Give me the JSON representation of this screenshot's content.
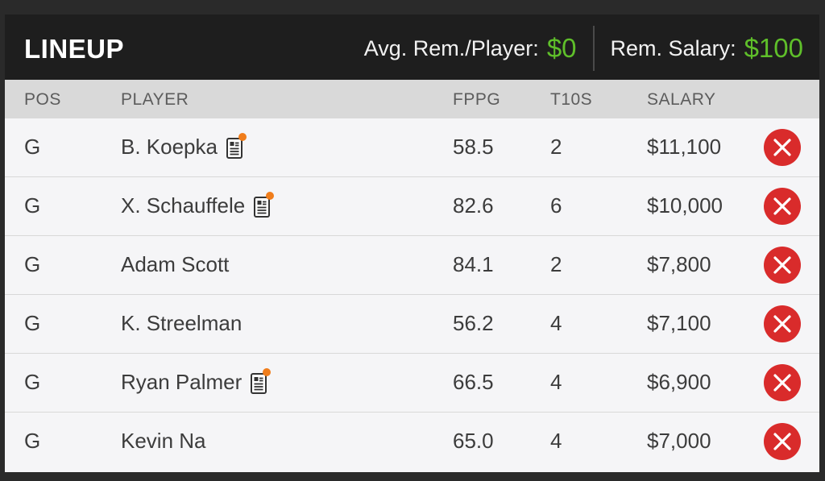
{
  "header": {
    "title": "LINEUP",
    "avg_label": "Avg. Rem./Player:",
    "avg_value": "$0",
    "rem_label": "Rem. Salary:",
    "rem_value": "$100"
  },
  "columns": {
    "pos": "POS",
    "player": "PLAYER",
    "fppg": "FPPG",
    "t10s": "T10S",
    "salary": "SALARY"
  },
  "colors": {
    "accent_green": "#5fbf2a",
    "remove_red": "#d92b2b",
    "news_dot_orange": "#f07d1b"
  },
  "players": [
    {
      "pos": "G",
      "name": "B. Koepka",
      "has_news": true,
      "fppg": "58.5",
      "t10s": "2",
      "salary": "$11,100"
    },
    {
      "pos": "G",
      "name": "X. Schauffele",
      "has_news": true,
      "fppg": "82.6",
      "t10s": "6",
      "salary": "$10,000"
    },
    {
      "pos": "G",
      "name": "Adam Scott",
      "has_news": false,
      "fppg": "84.1",
      "t10s": "2",
      "salary": "$7,800"
    },
    {
      "pos": "G",
      "name": "K. Streelman",
      "has_news": false,
      "fppg": "56.2",
      "t10s": "4",
      "salary": "$7,100"
    },
    {
      "pos": "G",
      "name": "Ryan Palmer",
      "has_news": true,
      "fppg": "66.5",
      "t10s": "4",
      "salary": "$6,900"
    },
    {
      "pos": "G",
      "name": "Kevin Na",
      "has_news": false,
      "fppg": "65.0",
      "t10s": "4",
      "salary": "$7,000"
    }
  ]
}
